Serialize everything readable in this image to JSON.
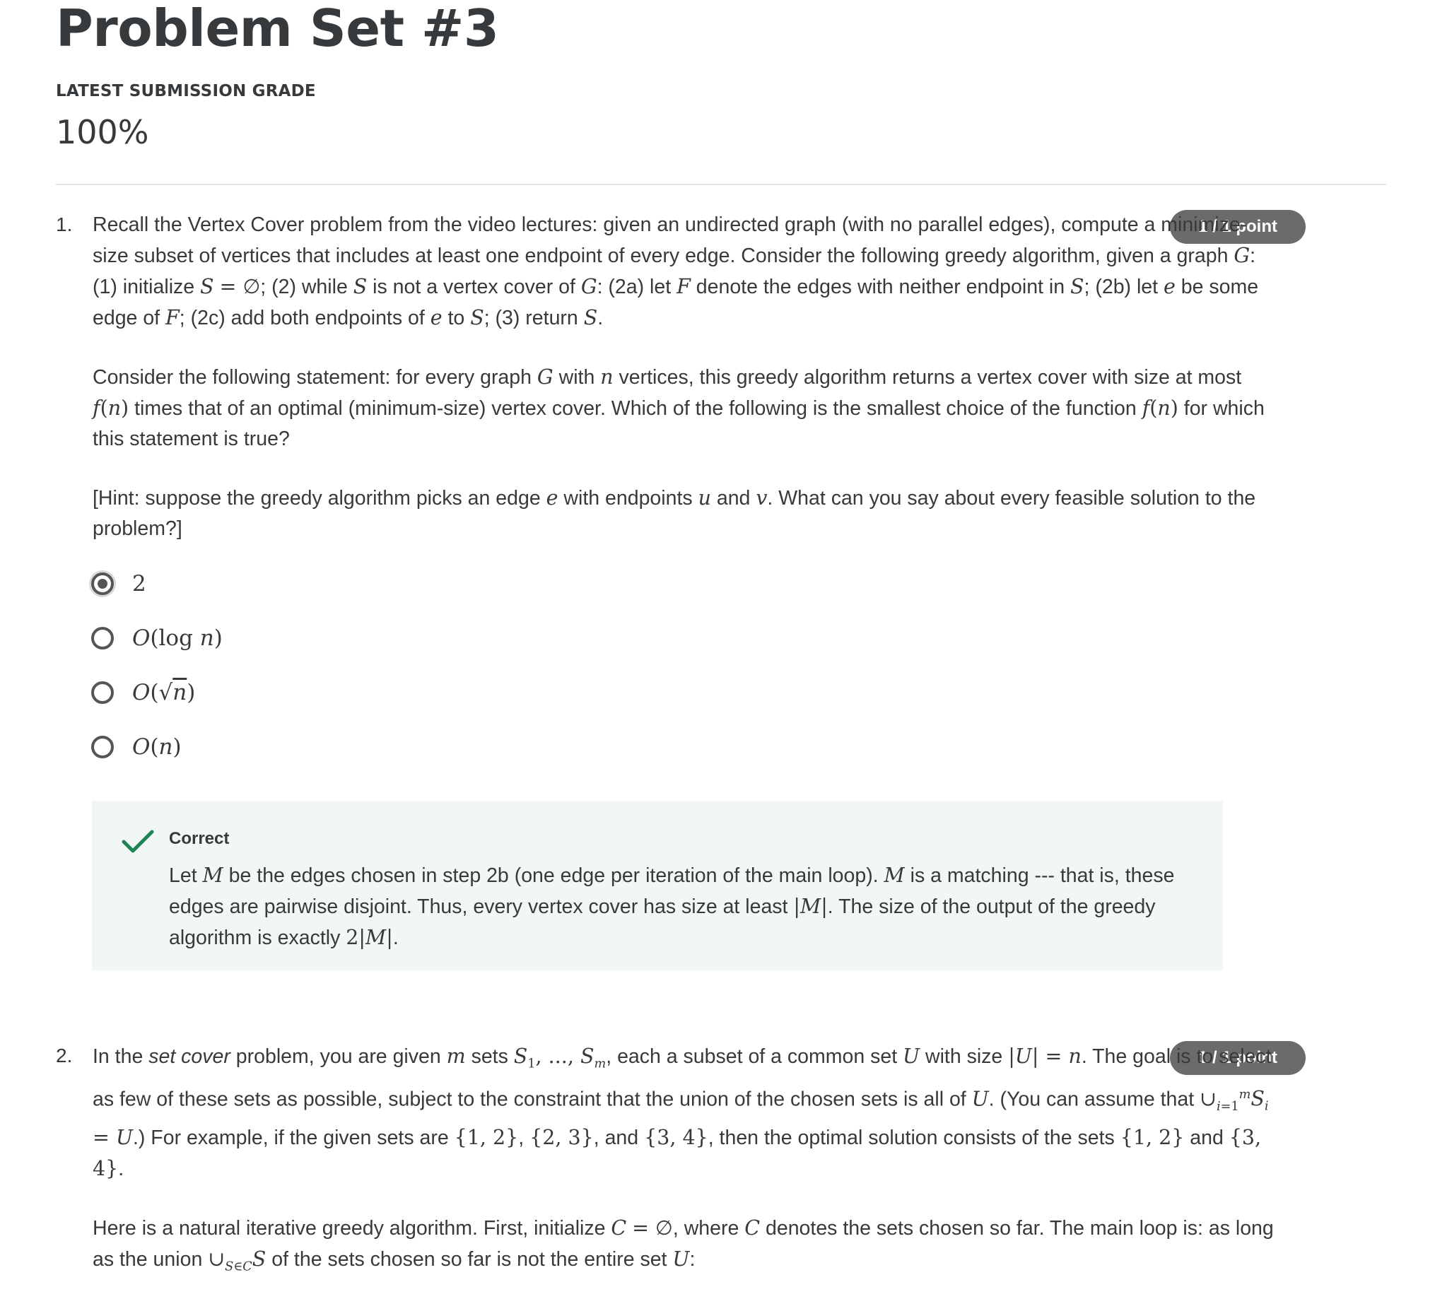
{
  "page": {
    "title": "Problem Set #3",
    "grade_label": "LATEST SUBMISSION GRADE",
    "grade_value": "100%"
  },
  "questions": [
    {
      "number": "1.",
      "points": "1 / 1 point",
      "options": [
        "2",
        "O(log n)",
        "O(√n)",
        "O(n)"
      ],
      "selected": "2",
      "feedback": {
        "status": "Correct"
      }
    },
    {
      "number": "2.",
      "points": "1 / 1 point"
    }
  ],
  "colors": {
    "badge": "#6b6b6b",
    "feedback_bg": "#f1f7f5",
    "check": "#1f8354",
    "text": "#373a3c"
  },
  "icons": {
    "selected_radio": "radio-selected-icon",
    "radio": "radio-icon",
    "check": "checkmark-icon"
  }
}
